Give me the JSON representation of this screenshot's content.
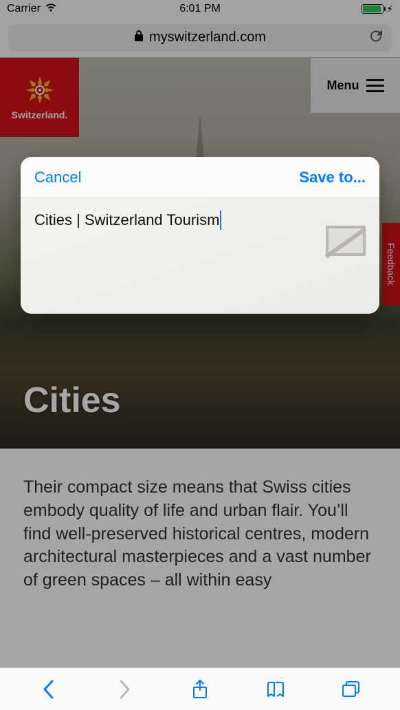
{
  "status_bar": {
    "carrier": "Carrier",
    "time": "6:01 PM"
  },
  "url_bar": {
    "domain": "myswitzerland.com"
  },
  "brand": {
    "label": "Switzerland."
  },
  "menu": {
    "label": "Menu"
  },
  "feedback_tab": "Feedback",
  "hero": {
    "title": "Cities"
  },
  "body_paragraph": "Their compact size means that Swiss cities embody quality of life and ur­ban flair. You’ll find well-preserved historical centres, modern architec­tural masterpieces and a vast num­ber of green spaces – all within easy",
  "modal": {
    "cancel": "Cancel",
    "save": "Save to...",
    "input_value": "Cities | Switzerland Tourism"
  },
  "colors": {
    "accent_ios": "#007aff",
    "brand_red": "#d41317",
    "battery_green": "#34c759"
  }
}
